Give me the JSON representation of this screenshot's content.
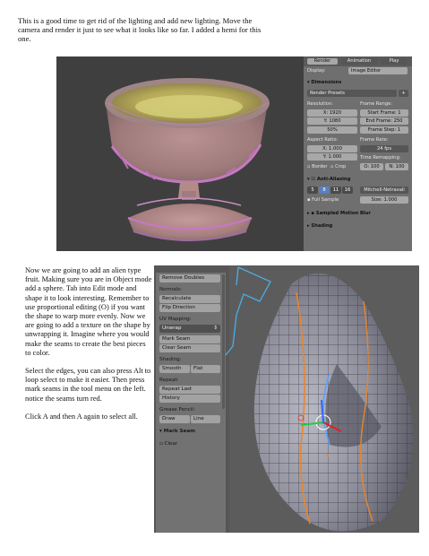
{
  "intro": "This is a good time to get rid of the lighting and add new lighting. Move the camera and render it just to see what it looks like so far. I added a hemi for this one.",
  "left_paragraphs": [
    "Now we are going to add an alien type fruit. Making sure you are in Object mode add a sphere. Tab into Edit mode and shape it to look interesting. Remember to use proportional editing (O) if you want the shape to warp more evenly. Now we are going to add a texture on the shape by unwrapping it. Imagine where you would make the seams to create the best pieces to color.",
    "Select the edges, you can also press Alt to loop select to make it easier. Then press mark seams in the tool menu on the left. notice the seams turn red.",
    "Click A and then A again to select all."
  ],
  "screenshot1": {
    "tabs": [
      "Render",
      "Animation",
      "Play"
    ],
    "display_label": "Display:",
    "display_value": "Image Editor",
    "dimensions_header": "Dimensions",
    "render_presets": "Render Presets",
    "resolution_label": "Resolution:",
    "res_x": "X: 1920",
    "res_y": "Y: 1080",
    "res_pct": "50%",
    "frame_range_label": "Frame Range:",
    "start_frame": "Start Frame: 1",
    "end_frame": "End Frame: 250",
    "frame_step": "Frame Step: 1",
    "aspect_label": "Aspect Ratio:",
    "aspect_x": "X: 1.000",
    "aspect_y": "Y: 1.000",
    "frame_rate_label": "Frame Rate:",
    "fps": "24 fps",
    "time_remap_label": "Time Remapping:",
    "remap_old": "O: 100",
    "remap_new": "N: 100",
    "border_label": "Border",
    "crop_label": "Crop",
    "aa_header": "Anti-Aliasing",
    "aa_samples": [
      "5",
      "8",
      "11",
      "16"
    ],
    "aa_filter": "Mitchell-Netravali",
    "full_sample": "Full Sample",
    "aa_size": "Size: 1.000",
    "motion_blur_header": "Sampled Motion Blur",
    "shading_header": "Shading"
  },
  "screenshot2": {
    "remove_doubles": "Remove Doubles",
    "normals_label": "Normals:",
    "recalculate": "Recalculate",
    "flip_direction": "Flip Direction",
    "uv_label": "UV Mapping:",
    "unwrap": "Unwrap",
    "mark_seam": "Mark Seam",
    "clear_seam": "Clear Seam",
    "shading_label": "Shading:",
    "smooth": "Smooth",
    "flat": "Flat",
    "repeat_label": "Repeat:",
    "repeat_last": "Repeat Last",
    "history": "History",
    "grease_label": "Grease Pencil:",
    "draw": "Draw",
    "line": "Line",
    "op_header": "Mark Seam",
    "clear_label": "Clear"
  }
}
